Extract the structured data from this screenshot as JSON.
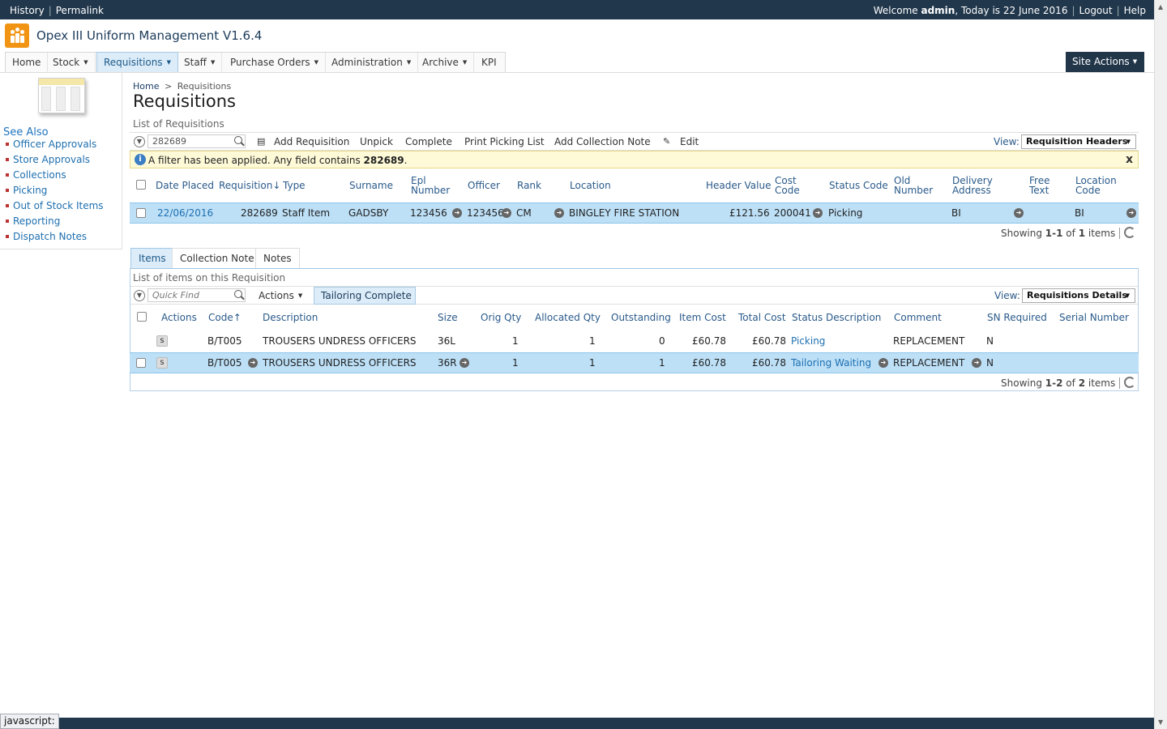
{
  "topbar": {
    "history": "History",
    "permalink": "Permalink",
    "welcome_prefix": "Welcome",
    "username": "admin",
    "date_text": ", Today is 22 June 2016",
    "logout": "Logout",
    "help": "Help"
  },
  "app": {
    "title": "Opex III Uniform Management V1.6.4"
  },
  "nav": {
    "items": [
      "Home",
      "Stock",
      "Requisitions",
      "Staff",
      "Purchase Orders",
      "Administration",
      "Archive",
      "KPI"
    ],
    "selected": "Requisitions",
    "site_actions": "Site Actions"
  },
  "sidebar": {
    "heading": "See Also",
    "links": [
      "Officer Approvals",
      "Store Approvals",
      "Collections",
      "Picking",
      "Out of Stock Items",
      "Reporting",
      "Dispatch Notes"
    ]
  },
  "breadcrumb": {
    "home": "Home",
    "sep": ">",
    "current": "Requisitions"
  },
  "page": {
    "title": "Requisitions",
    "list_label": "List of Requisitions"
  },
  "req_toolbar": {
    "search_value": "282689",
    "buttons": [
      "Add Requisition",
      "Unpick",
      "Complete",
      "Print Picking List",
      "Add Collection Note",
      "Edit"
    ],
    "view_label": "View:",
    "view_value": "Requisition Headers"
  },
  "filter": {
    "text": "A filter has been applied. Any field contains ",
    "value": "282689",
    "suffix": ".",
    "close": "x"
  },
  "req_table": {
    "headers": [
      "Date Placed",
      "Requisition",
      "Type",
      "Surname",
      "Epl Number",
      "Officer",
      "Rank",
      "Location",
      "Header Value",
      "Cost Code",
      "Status Code",
      "Old Number",
      "Delivery Address",
      "Free Text",
      "Location Code"
    ],
    "sort_indicator": "↓",
    "row": {
      "date_placed": "22/06/2016",
      "requisition": "282689",
      "type": "Staff Item",
      "surname": "GADSBY",
      "epl_number": "123456",
      "officer": "123456",
      "rank": "CM",
      "location": "BINGLEY FIRE STATION",
      "header_value": "£121.56",
      "cost_code": "200041",
      "status_code": "Picking",
      "delivery_address": "BI",
      "location_code": "BI"
    },
    "footer": {
      "prefix": "Showing",
      "range": "1-1",
      "of": "of",
      "total": "1",
      "suffix": "items"
    }
  },
  "tabs": {
    "items": [
      "Items",
      "Collection Note",
      "Notes"
    ],
    "selected": "Items"
  },
  "items_section": {
    "list_label": "List of items on this Requisition",
    "search_placeholder": "Quick Find",
    "actions": "Actions",
    "tailoring_button": "Tailoring Complete",
    "view_label": "View:",
    "view_value": "Requisitions Details"
  },
  "items_table": {
    "headers": [
      "Actions",
      "Code",
      "Description",
      "Size",
      "Orig Qty",
      "Allocated Qty",
      "Outstanding",
      "Item Cost",
      "Total Cost",
      "Status Description",
      "Comment",
      "SN Required",
      "Serial Number"
    ],
    "sort_indicator": "↑",
    "rows": [
      {
        "action": "s",
        "code": "B/T005",
        "description": "TROUSERS UNDRESS OFFICERS",
        "size": "36L",
        "orig_qty": "1",
        "allocated_qty": "1",
        "outstanding": "0",
        "item_cost": "£60.78",
        "total_cost": "£60.78",
        "status": "Picking",
        "comment": "REPLACEMENT",
        "sn_required": "N"
      },
      {
        "action": "s",
        "code": "B/T005",
        "description": "TROUSERS UNDRESS OFFICERS",
        "size": "36R",
        "orig_qty": "1",
        "allocated_qty": "1",
        "outstanding": "1",
        "item_cost": "£60.78",
        "total_cost": "£60.78",
        "status": "Tailoring Waiting",
        "comment": "REPLACEMENT",
        "sn_required": "N"
      }
    ],
    "footer": {
      "prefix": "Showing",
      "range": "1-2",
      "of": "of",
      "total": "2",
      "suffix": "items"
    }
  },
  "statusbar": {
    "text": "javascript:"
  }
}
